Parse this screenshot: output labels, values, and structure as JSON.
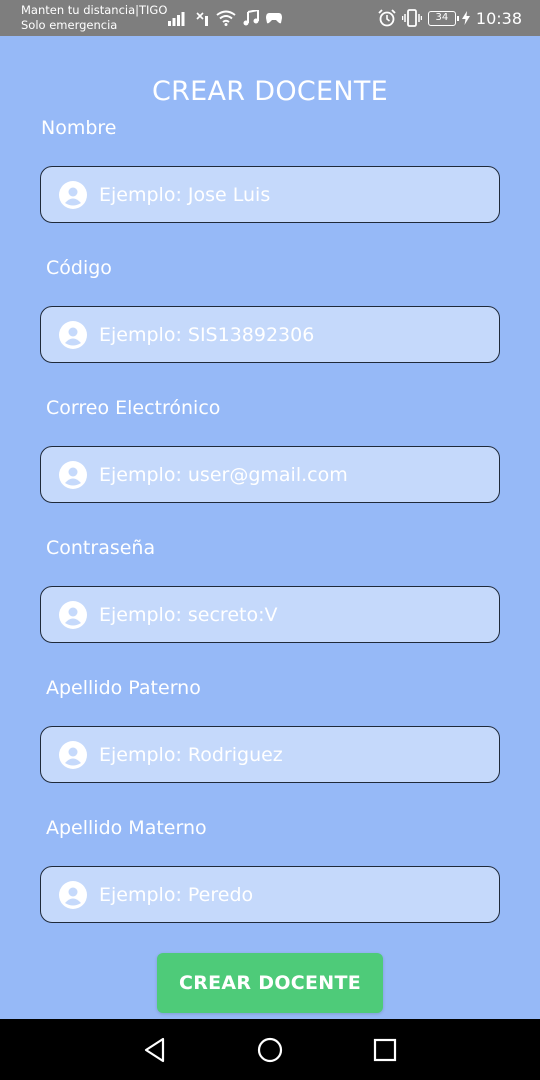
{
  "status_bar": {
    "carrier_line1": "Manten tu distancia|TIGO",
    "carrier_line2": "Solo emergencia",
    "battery": "34",
    "time": "10:38"
  },
  "title": "CREAR DOCENTE",
  "fields": [
    {
      "label": "Nombre",
      "placeholder": "Ejemplo: Jose Luis"
    },
    {
      "label": "Código",
      "placeholder": "Ejemplo: SIS13892306"
    },
    {
      "label": "Correo Electrónico",
      "placeholder": "Ejemplo: user@gmail.com"
    },
    {
      "label": "Contraseña",
      "placeholder": "Ejemplo: secreto:V"
    },
    {
      "label": "Apellido Paterno",
      "placeholder": "Ejemplo: Rodriguez"
    },
    {
      "label": "Apellido Materno",
      "placeholder": "Ejemplo: Peredo"
    }
  ],
  "submit_label": "CREAR DOCENTE",
  "colors": {
    "background": "#96b9f7",
    "field_fill": "#c5d9fb",
    "button": "#4ecb79"
  }
}
